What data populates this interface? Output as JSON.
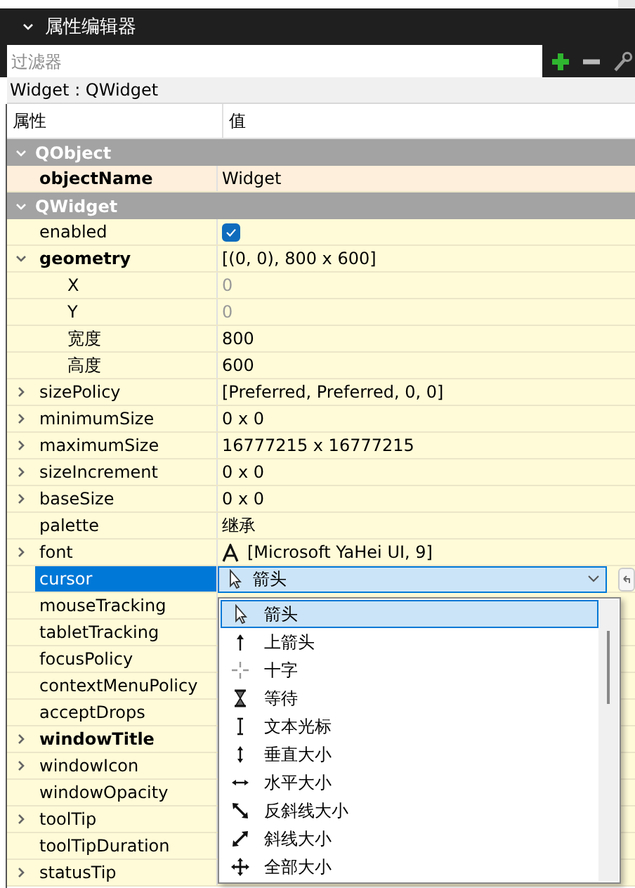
{
  "panel": {
    "title": "属性编辑器",
    "filter": {
      "placeholder": "过滤器"
    },
    "object_label": "Widget : QWidget",
    "columns": [
      "属性",
      "值"
    ]
  },
  "groups": [
    {
      "name": "QObject",
      "expanded": true,
      "color": "#fdefdb",
      "rows": [
        {
          "name": "objectName",
          "bold": true,
          "value": "Widget",
          "kind": "text"
        }
      ]
    },
    {
      "name": "QWidget",
      "expanded": true,
      "color": "#fffbd8",
      "rows": [
        {
          "name": "enabled",
          "kind": "checkbox",
          "checked": true
        },
        {
          "name": "geometry",
          "bold": true,
          "value": "[(0, 0), 800 x 600]",
          "kind": "text",
          "expanded": true,
          "children": [
            {
              "name": "X",
              "value": "0",
              "kind": "text",
              "disabled": true
            },
            {
              "name": "Y",
              "value": "0",
              "kind": "text",
              "disabled": true
            },
            {
              "name": "宽度",
              "value": "800",
              "kind": "text",
              "disabled": false
            },
            {
              "name": "高度",
              "value": "600",
              "kind": "text",
              "disabled": false
            }
          ]
        },
        {
          "name": "sizePolicy",
          "value": "[Preferred, Preferred, 0, 0]",
          "kind": "text",
          "expanded": false
        },
        {
          "name": "minimumSize",
          "value": "0 x 0",
          "kind": "text",
          "expanded": false
        },
        {
          "name": "maximumSize",
          "value": "16777215 x 16777215",
          "kind": "text",
          "expanded": false
        },
        {
          "name": "sizeIncrement",
          "value": "0 x 0",
          "kind": "text",
          "expanded": false
        },
        {
          "name": "baseSize",
          "value": "0 x 0",
          "kind": "text",
          "expanded": false
        },
        {
          "name": "palette",
          "value": "继承",
          "kind": "text"
        },
        {
          "name": "font",
          "value": "[Microsoft YaHei UI, 9]",
          "kind": "font",
          "expanded": false
        },
        {
          "name": "cursor",
          "kind": "combo",
          "selected": true,
          "value": "箭头",
          "options": [
            {
              "label": "箭头",
              "kind": "arrow",
              "selected": true
            },
            {
              "label": "上箭头",
              "kind": "up",
              "selected": false
            },
            {
              "label": "十字",
              "kind": "cross",
              "selected": false
            },
            {
              "label": "等待",
              "kind": "wait",
              "selected": false
            },
            {
              "label": "文本光标",
              "kind": "ibeam",
              "selected": false
            },
            {
              "label": "垂直大小",
              "kind": "ver",
              "selected": false
            },
            {
              "label": "水平大小",
              "kind": "hor",
              "selected": false
            },
            {
              "label": "反斜线大小",
              "kind": "bdiag",
              "selected": false
            },
            {
              "label": "斜线大小",
              "kind": "fdiag",
              "selected": false
            },
            {
              "label": "全部大小",
              "kind": "all",
              "selected": false
            }
          ]
        },
        {
          "name": "mouseTracking",
          "kind": "hidden"
        },
        {
          "name": "tabletTracking",
          "kind": "hidden"
        },
        {
          "name": "focusPolicy",
          "kind": "hidden"
        },
        {
          "name": "contextMenuPolicy",
          "kind": "hidden"
        },
        {
          "name": "acceptDrops",
          "kind": "hidden"
        },
        {
          "name": "windowTitle",
          "bold": true,
          "kind": "hidden",
          "expanded": false
        },
        {
          "name": "windowIcon",
          "kind": "hidden",
          "expanded": false
        },
        {
          "name": "windowOpacity",
          "kind": "hidden"
        },
        {
          "name": "toolTip",
          "kind": "hidden",
          "expanded": false
        },
        {
          "name": "toolTipDuration",
          "kind": "hidden"
        },
        {
          "name": "statusTip",
          "kind": "hidden",
          "expanded": false
        }
      ]
    }
  ]
}
